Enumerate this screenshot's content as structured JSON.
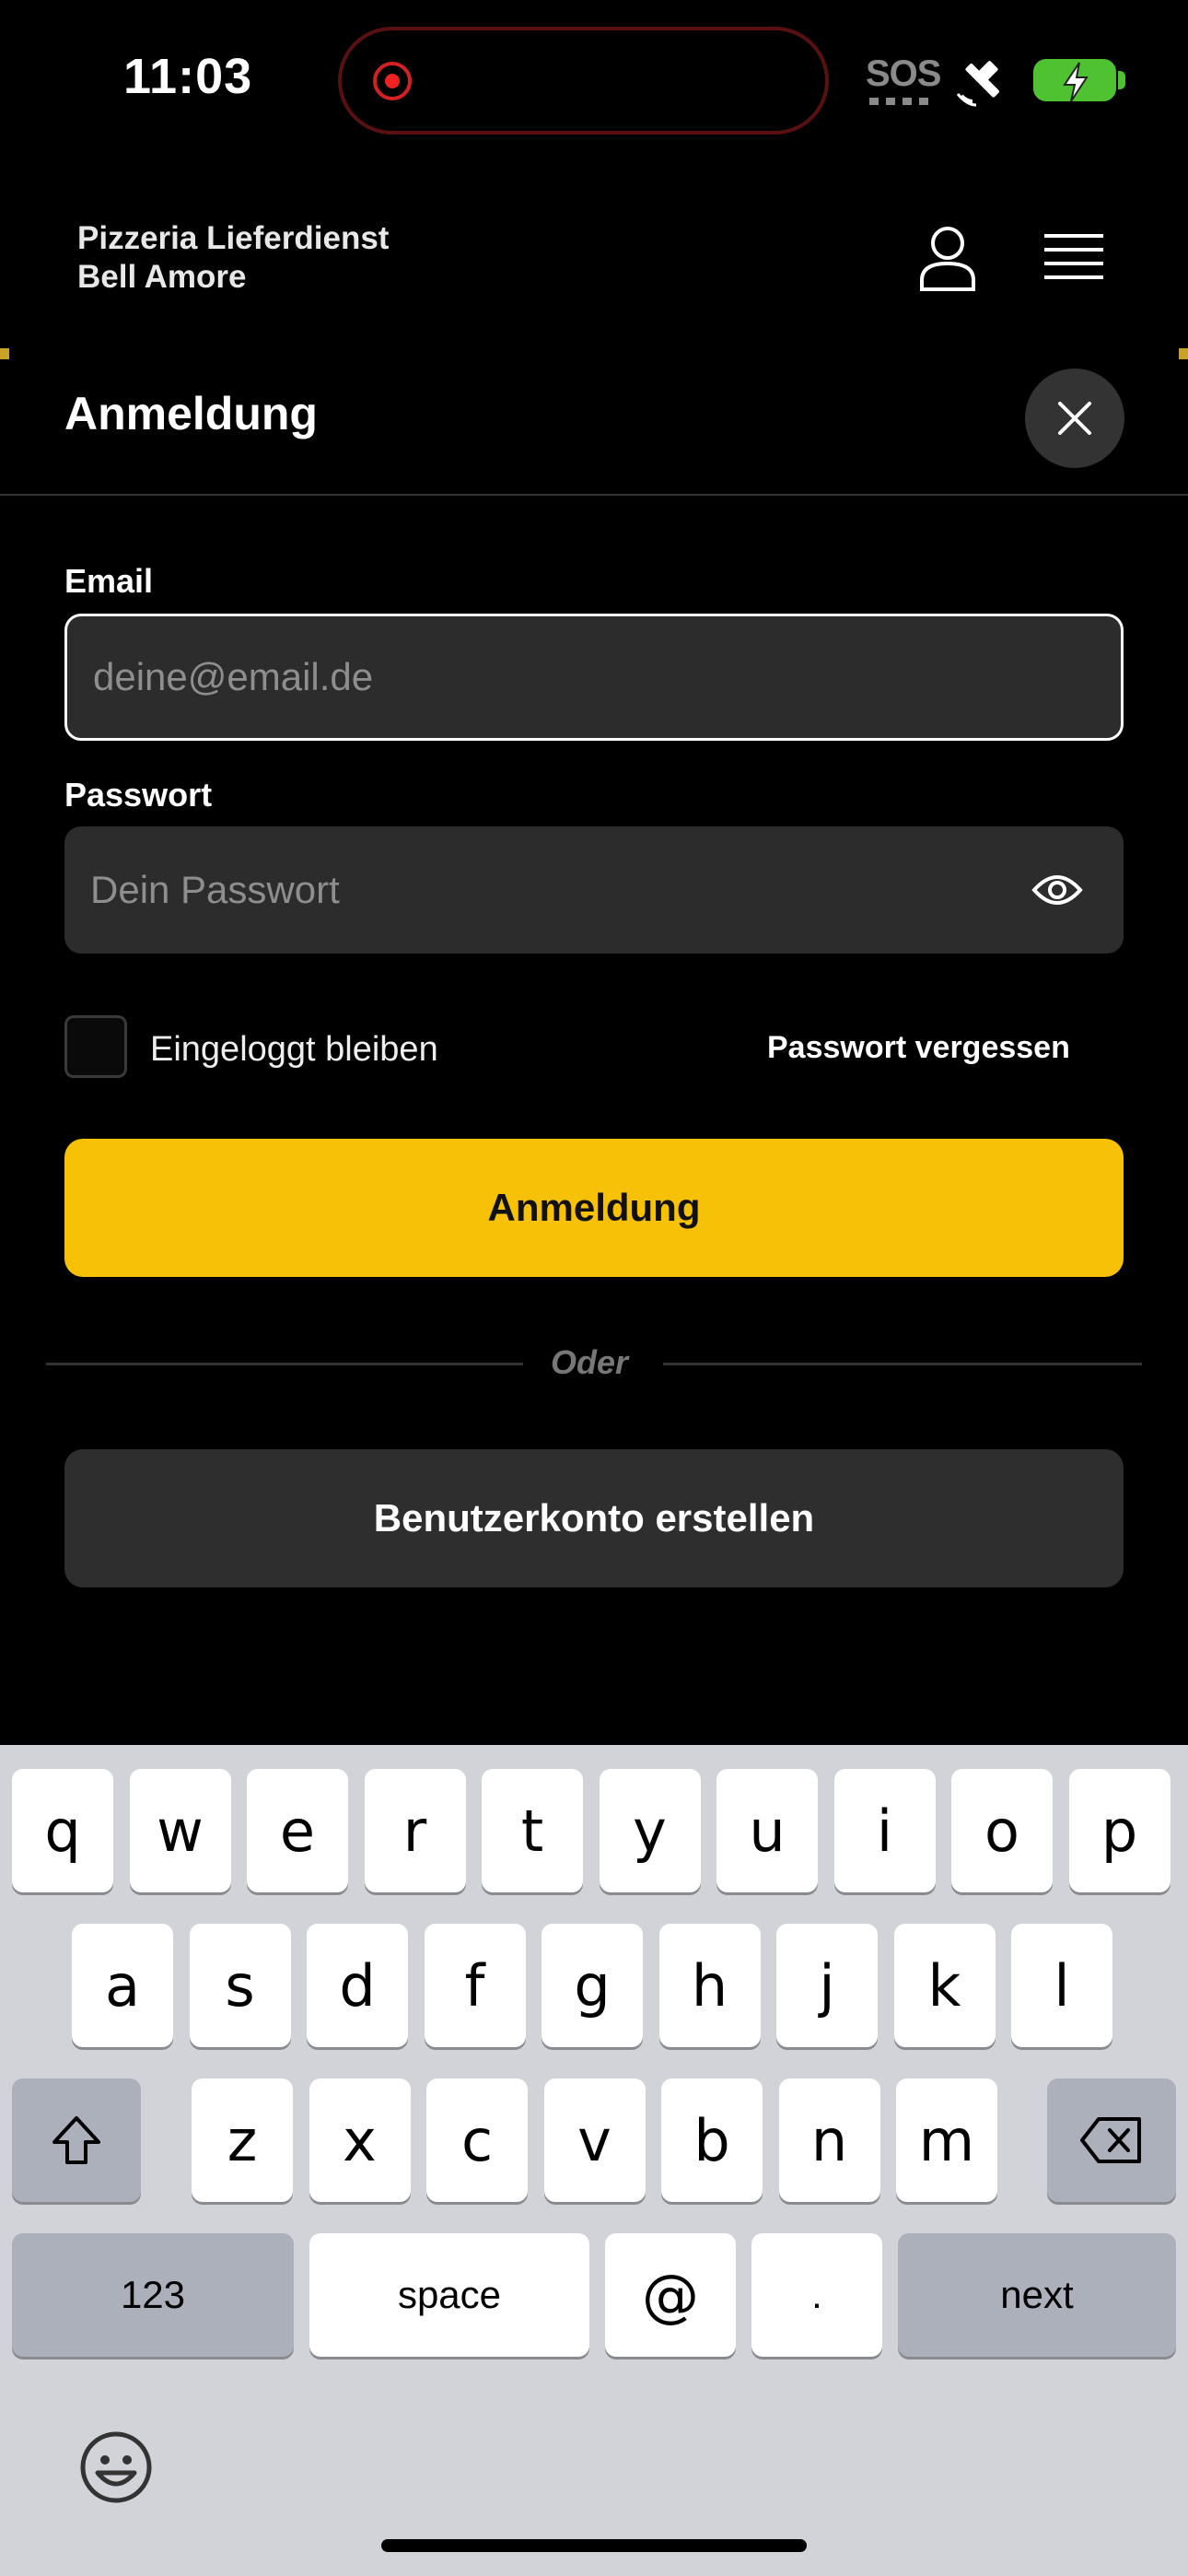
{
  "status_bar": {
    "time": "11:03",
    "sos": "SOS",
    "battery_color": "#4ec230"
  },
  "header": {
    "brand_line1": "Pizzeria Lieferdienst",
    "brand_line2": "Bell Amore",
    "user_icon": "user-icon",
    "menu_icon": "hamburger-menu-icon"
  },
  "modal": {
    "title": "Anmeldung",
    "close_icon": "close-icon"
  },
  "form": {
    "email_label": "Email",
    "email_placeholder": "deine@email.de",
    "email_value": "",
    "password_label": "Passwort",
    "password_placeholder": "Dein Passwort",
    "password_value": "",
    "remember_label": "Eingeloggt bleiben",
    "remember_checked": false,
    "forgot_label": "Passwort vergessen",
    "login_label": "Anmeldung",
    "or_label": "Oder",
    "register_label": "Benutzerkonto erstellen",
    "accent_color": "#f6c107"
  },
  "keyboard": {
    "row1": [
      "q",
      "w",
      "e",
      "r",
      "t",
      "y",
      "u",
      "i",
      "o",
      "p"
    ],
    "row2": [
      "a",
      "s",
      "d",
      "f",
      "g",
      "h",
      "j",
      "k",
      "l"
    ],
    "row3": [
      "z",
      "x",
      "c",
      "v",
      "b",
      "n",
      "m"
    ],
    "numbers_label": "123",
    "space_label": "space",
    "at_label": "@",
    "dot_label": ".",
    "next_label": "next"
  }
}
